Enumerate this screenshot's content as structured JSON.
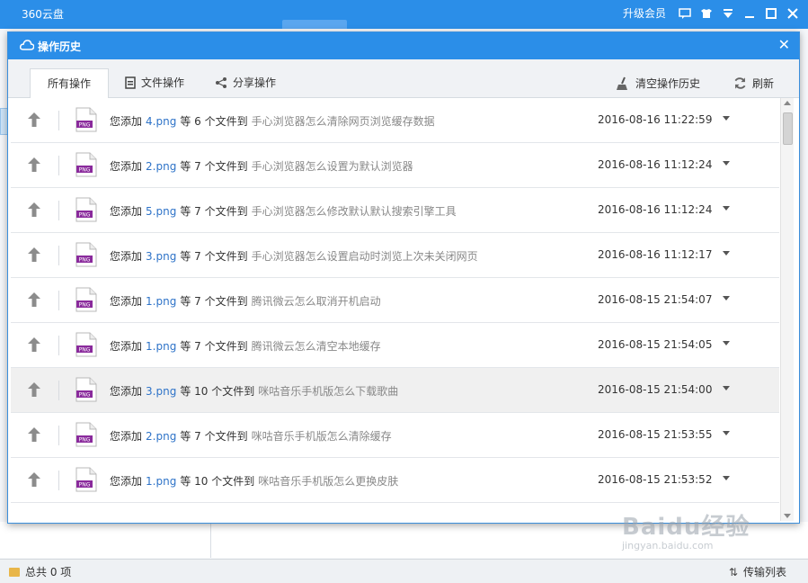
{
  "app": {
    "title": "360云盘",
    "upgrade_label": "升级会员",
    "status_total": "总共 0 项",
    "transfer_list_label": "传输列表"
  },
  "dialog": {
    "title": "操作历史",
    "tabs": [
      {
        "label": "所有操作",
        "active": true
      },
      {
        "label": "文件操作",
        "active": false
      },
      {
        "label": "分享操作",
        "active": false
      }
    ],
    "clear_label": "清空操作历史",
    "refresh_label": "刷新",
    "file_type_badge": "PNG"
  },
  "history": [
    {
      "prefix": "您添加",
      "file": "4.png",
      "mid": "等 6 个文件到",
      "folder": "手心浏览器怎么清除网页浏览缓存数据",
      "time": "2016-08-16 11:22:59",
      "highlight": false
    },
    {
      "prefix": "您添加",
      "file": "2.png",
      "mid": "等 7 个文件到",
      "folder": "手心浏览器怎么设置为默认浏览器",
      "time": "2016-08-16 11:12:24",
      "highlight": false
    },
    {
      "prefix": "您添加",
      "file": "5.png",
      "mid": "等 7 个文件到",
      "folder": "手心浏览器怎么修改默认默认搜索引擎工具",
      "time": "2016-08-16 11:12:24",
      "highlight": false
    },
    {
      "prefix": "您添加",
      "file": "3.png",
      "mid": "等 7 个文件到",
      "folder": "手心浏览器怎么设置启动时浏览上次未关闭网页",
      "time": "2016-08-16 11:12:17",
      "highlight": false
    },
    {
      "prefix": "您添加",
      "file": "1.png",
      "mid": "等 7 个文件到",
      "folder": "腾讯微云怎么取消开机启动",
      "time": "2016-08-15 21:54:07",
      "highlight": false
    },
    {
      "prefix": "您添加",
      "file": "1.png",
      "mid": "等 7 个文件到",
      "folder": "腾讯微云怎么清空本地缓存",
      "time": "2016-08-15 21:54:05",
      "highlight": false
    },
    {
      "prefix": "您添加",
      "file": "3.png",
      "mid": "等 10 个文件到",
      "folder": "咪咕音乐手机版怎么下载歌曲",
      "time": "2016-08-15 21:54:00",
      "highlight": true
    },
    {
      "prefix": "您添加",
      "file": "2.png",
      "mid": "等 7 个文件到",
      "folder": "咪咕音乐手机版怎么清除缓存",
      "time": "2016-08-15 21:53:55",
      "highlight": false
    },
    {
      "prefix": "您添加",
      "file": "1.png",
      "mid": "等 10 个文件到",
      "folder": "咪咕音乐手机版怎么更换皮肤",
      "time": "2016-08-15 21:53:52",
      "highlight": false
    }
  ],
  "watermark": {
    "brand": "Baidu经验",
    "url": "jingyan.baidu.com"
  },
  "colors": {
    "accent": "#2b8ee8",
    "link": "#2e73c8",
    "png_badge": "#8a2a9c"
  }
}
